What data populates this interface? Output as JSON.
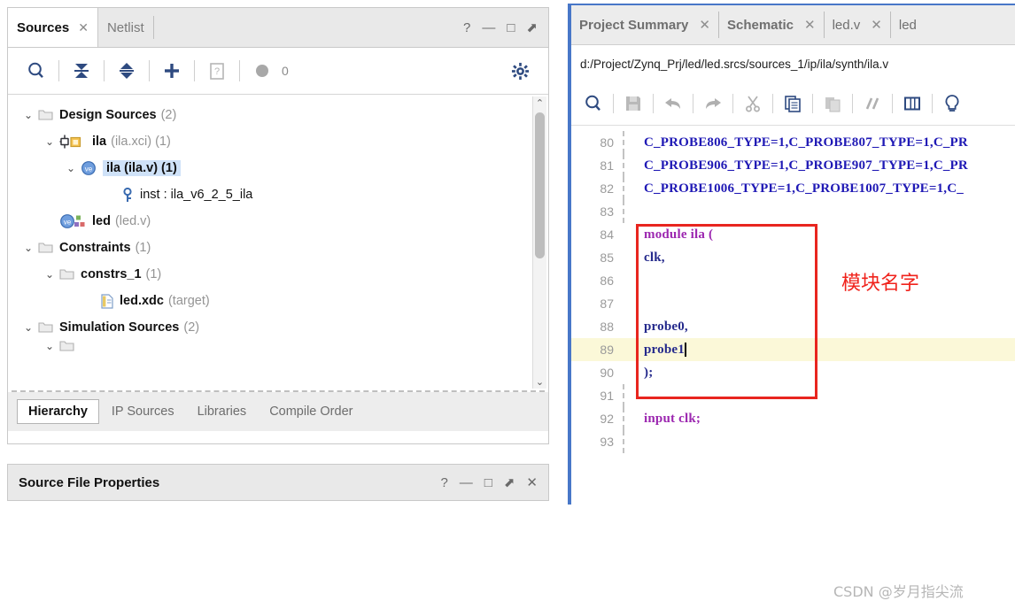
{
  "sources_panel": {
    "tabs": [
      {
        "label": "Sources",
        "active": true,
        "closable": true
      },
      {
        "label": "Netlist",
        "active": false,
        "closable": false
      }
    ],
    "window_buttons": [
      "?",
      "—",
      "□",
      "⬈"
    ],
    "toolbar": {
      "icons": [
        {
          "name": "search-icon",
          "glyph": "Q"
        },
        {
          "name": "collapse-all-icon",
          "glyph": "collapse"
        },
        {
          "name": "expand-all-icon",
          "glyph": "expand"
        },
        {
          "name": "add-sources-icon",
          "glyph": "+"
        },
        {
          "name": "help-file-icon",
          "glyph": "?"
        },
        {
          "name": "status-dot-icon",
          "glyph": "●"
        },
        {
          "name": "settings-gear-icon",
          "glyph": "gear"
        }
      ],
      "badge_count": "0"
    },
    "tree": [
      {
        "indent": 0,
        "chevron": "v",
        "icon": "folder-icon",
        "name": "Design Sources",
        "dim": "(2)",
        "selected": false
      },
      {
        "indent": 1,
        "chevron": "v",
        "icon": "ip-core-icon",
        "name": "ila",
        "dim": "(ila.xci) (1)",
        "selected": false
      },
      {
        "indent": 2,
        "chevron": "v",
        "icon": "verilog-file-icon",
        "name": "ila (ila.v) (1)",
        "dim": "",
        "selected": true
      },
      {
        "indent": 3,
        "chevron": "",
        "icon": "instance-key-icon",
        "name": "inst : ila_v6_2_5_ila",
        "dim": "",
        "selected": false
      },
      {
        "indent": 1,
        "chevron": "",
        "icon": "verilog-top-icon",
        "name": "led",
        "dim": "(led.v)",
        "selected": false
      },
      {
        "indent": 0,
        "chevron": "v",
        "icon": "folder-icon",
        "name": "Constraints",
        "dim": "(1)",
        "selected": false
      },
      {
        "indent": 1,
        "chevron": "v",
        "icon": "folder-icon",
        "name": "constrs_1",
        "dim": "(1)",
        "selected": false
      },
      {
        "indent": 2,
        "chevron": "",
        "icon": "xdc-file-icon",
        "name": "led.xdc",
        "dim": "(target)",
        "selected": false
      },
      {
        "indent": 0,
        "chevron": "v",
        "icon": "folder-icon",
        "name": "Simulation Sources",
        "dim": "(2)",
        "selected": false
      }
    ],
    "bottom_tabs": [
      {
        "label": "Hierarchy",
        "active": true
      },
      {
        "label": "IP Sources",
        "active": false
      },
      {
        "label": "Libraries",
        "active": false
      },
      {
        "label": "Compile Order",
        "active": false
      }
    ]
  },
  "properties_panel": {
    "title": "Source File Properties",
    "window_buttons": [
      "?",
      "—",
      "□",
      "⬈",
      "✕"
    ]
  },
  "editor_panel": {
    "tabs": [
      {
        "label": "Project Summary",
        "closable": true
      },
      {
        "label": "Schematic",
        "closable": true
      },
      {
        "label": "led.v",
        "closable": true
      },
      {
        "label": "led",
        "closable": false
      }
    ],
    "file_path": "d:/Project/Zynq_Prj/led/led.srcs/sources_1/ip/ila/synth/ila.v",
    "toolbar": {
      "icons": [
        {
          "name": "find-icon",
          "glyph": "Q"
        },
        {
          "name": "save-icon",
          "glyph": "save"
        },
        {
          "name": "undo-icon",
          "glyph": "↩"
        },
        {
          "name": "redo-icon",
          "glyph": "↪"
        },
        {
          "name": "cut-icon",
          "glyph": "✂"
        },
        {
          "name": "copy-icon",
          "glyph": "copy"
        },
        {
          "name": "paste-icon",
          "glyph": "paste"
        },
        {
          "name": "comment-icon",
          "glyph": "//"
        },
        {
          "name": "table-icon",
          "glyph": "table"
        },
        {
          "name": "bulb-icon",
          "glyph": "bulb"
        }
      ]
    },
    "code_lines": [
      {
        "num": "80",
        "text": "C_PROBE806_TYPE=1,C_PROBE807_TYPE=1,C_PR",
        "style": "blue",
        "highlight": false,
        "gutter": true
      },
      {
        "num": "81",
        "text": "C_PROBE906_TYPE=1,C_PROBE907_TYPE=1,C_PR",
        "style": "blue",
        "highlight": false,
        "gutter": true
      },
      {
        "num": "82",
        "text": "C_PROBE1006_TYPE=1,C_PROBE1007_TYPE=1,C_",
        "style": "blue",
        "highlight": false,
        "gutter": true
      },
      {
        "num": "83",
        "text": "",
        "style": "plain",
        "highlight": false,
        "gutter": true
      },
      {
        "num": "84",
        "text": "module ila (",
        "style": "keyword",
        "highlight": false,
        "gutter": false
      },
      {
        "num": "85",
        "text": "clk,",
        "style": "navy",
        "highlight": false,
        "gutter": false
      },
      {
        "num": "86",
        "text": "",
        "style": "plain",
        "highlight": false,
        "gutter": false
      },
      {
        "num": "87",
        "text": "",
        "style": "plain",
        "highlight": false,
        "gutter": false
      },
      {
        "num": "88",
        "text": "probe0,",
        "style": "navy",
        "highlight": false,
        "gutter": false
      },
      {
        "num": "89",
        "text": "probe1",
        "style": "navy",
        "highlight": true,
        "gutter": false,
        "caret": true
      },
      {
        "num": "90",
        "text": ");",
        "style": "navy",
        "highlight": false,
        "gutter": false
      },
      {
        "num": "91",
        "text": "",
        "style": "plain",
        "highlight": false,
        "gutter": true
      },
      {
        "num": "92",
        "text": "input clk;",
        "style": "keyword2",
        "highlight": false,
        "gutter": true
      },
      {
        "num": "93",
        "text": "",
        "style": "plain",
        "highlight": false,
        "gutter": true
      }
    ],
    "annotation": {
      "text": "模块名字",
      "color": "#f0231c"
    },
    "watermark": "CSDN @岁月指尖流",
    "highlight_box_color": "#e8251f"
  }
}
